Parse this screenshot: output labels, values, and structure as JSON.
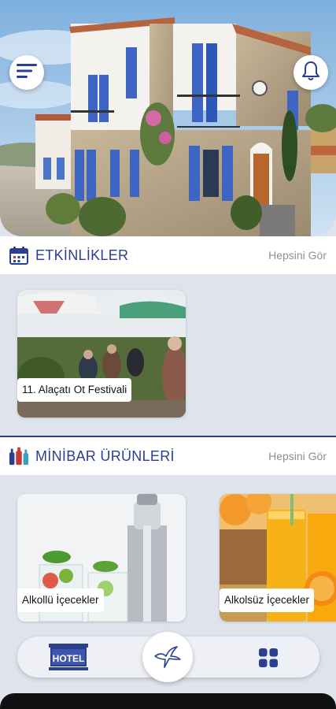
{
  "hero": {
    "menu_icon": "hamburger-menu-icon",
    "bell_icon": "bell-icon"
  },
  "events": {
    "title": "ETKİNLİKLER",
    "see_all": "Hepsini Gör",
    "icon": "calendar-icon",
    "items": [
      {
        "label": "11. Alaçatı Ot Festivali"
      }
    ]
  },
  "minibar": {
    "title": "MİNİBAR ÜRÜNLERİ",
    "see_all": "Hepsini Gör",
    "icon": "bottles-icon",
    "items": [
      {
        "label": "Alkollü İçecekler"
      },
      {
        "label": "Alkolsüz İçecekler"
      }
    ]
  },
  "bottom_nav": {
    "hotel_label": "HOTEL",
    "center_icon": "bird-logo-icon",
    "grid_icon": "grid-icon"
  },
  "colors": {
    "accent": "#2b3f8f",
    "background": "#dfe3ec"
  }
}
